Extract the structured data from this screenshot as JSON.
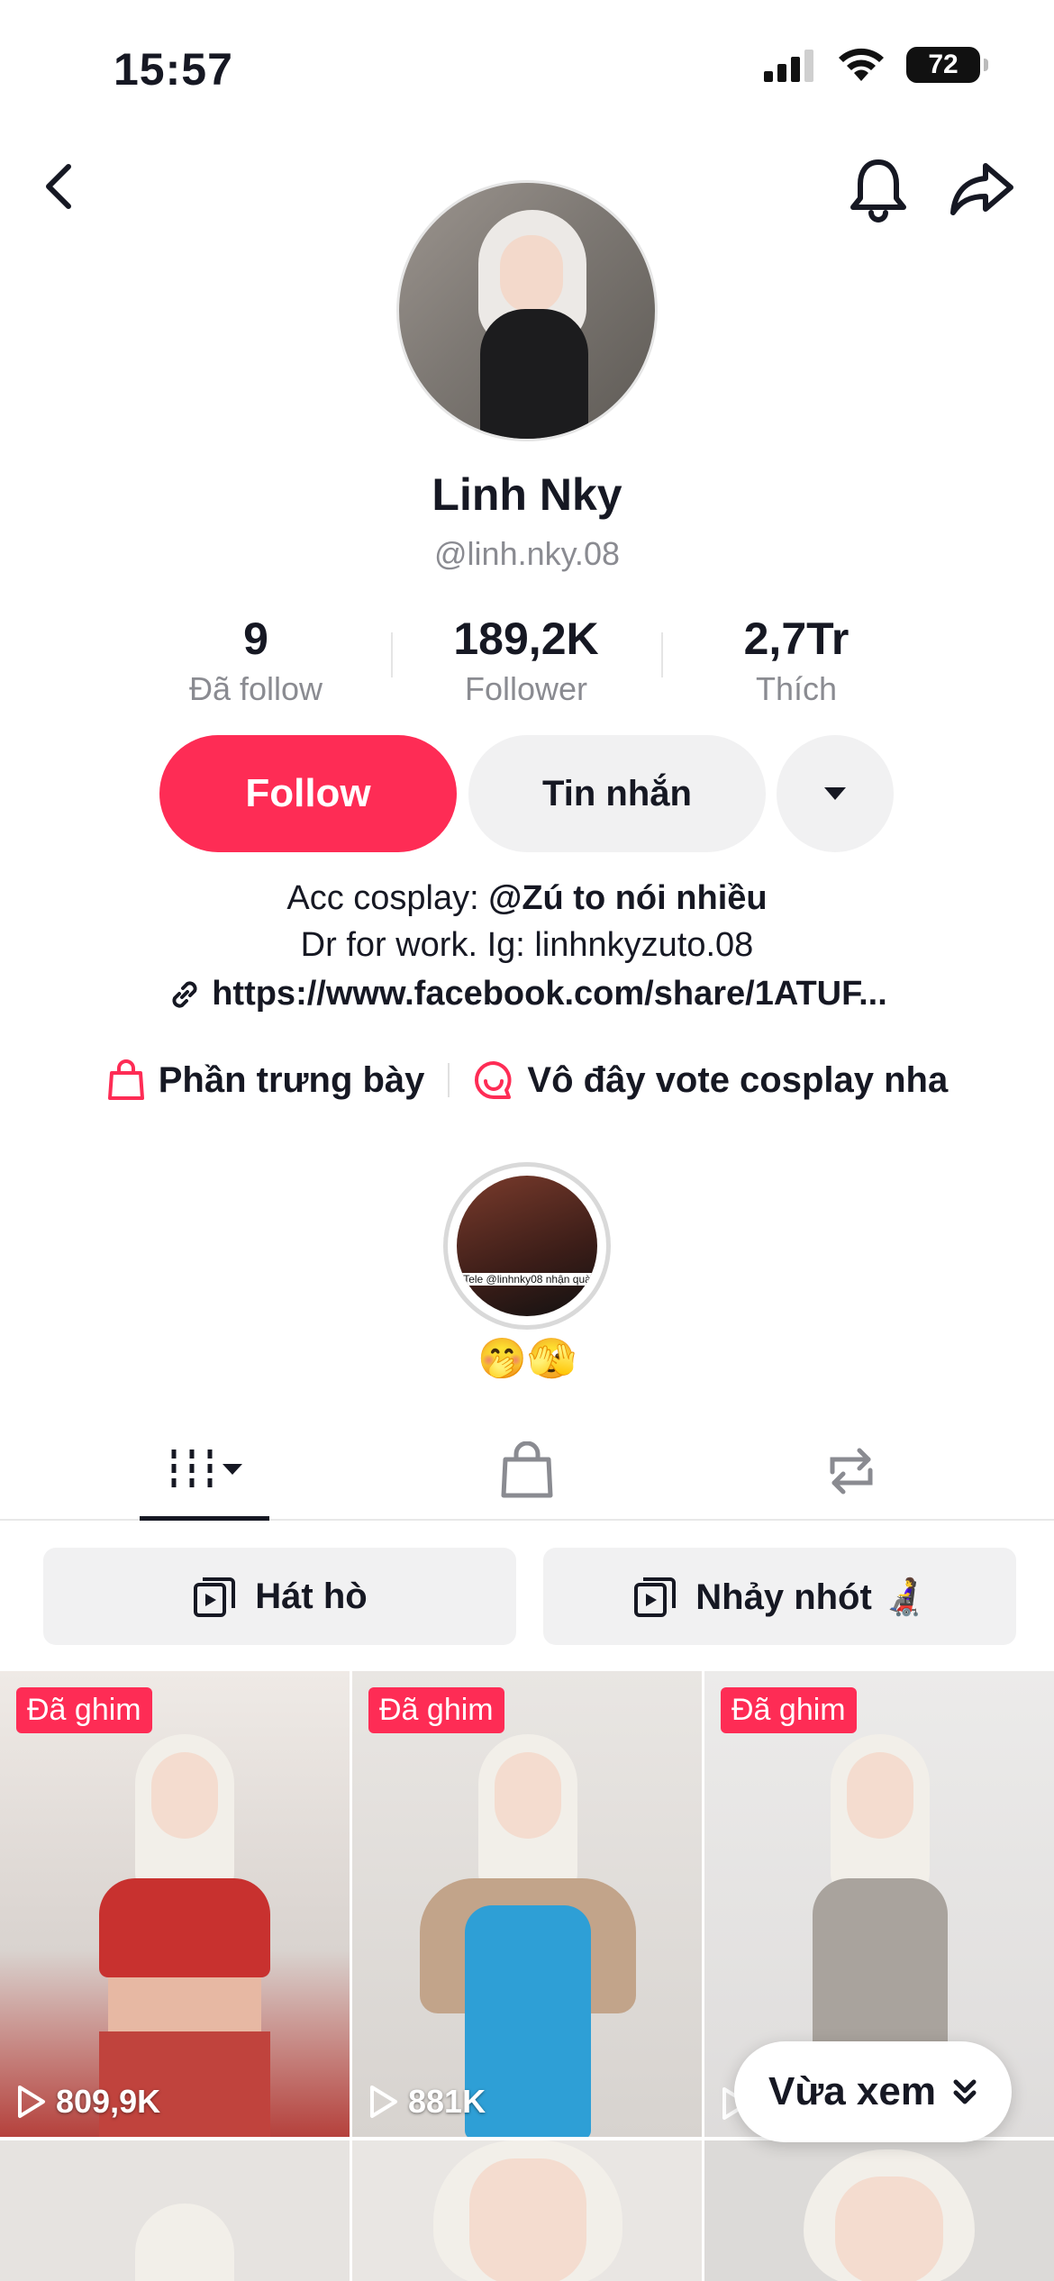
{
  "status_bar": {
    "time": "15:57",
    "battery": "72"
  },
  "profile": {
    "name": "Linh Nky",
    "handle": "@linh.nky.08",
    "stats": [
      {
        "value": "9",
        "label": "Đã follow"
      },
      {
        "value": "189,2K",
        "label": "Follower"
      },
      {
        "value": "2,7Tr",
        "label": "Thích"
      }
    ]
  },
  "actions": {
    "follow": "Follow",
    "message": "Tin nhắn"
  },
  "bio": {
    "line1_prefix": "Acc cosplay: ",
    "line1_mention": "@Zú to nói nhiều",
    "line2": "Dr for work. Ig: linhnkyzuto.08",
    "link": "https://www.facebook.com/share/1ATUF..."
  },
  "links": {
    "showcase": "Phần trưng bày",
    "vote": "Vô đây vote cosplay nha"
  },
  "highlight": {
    "label": "🤭🫣",
    "image_text": "Tele @linhnky08 nhận quà"
  },
  "playlists": [
    {
      "label": "Hát hò"
    },
    {
      "label": "Nhảy nhót 👩‍🦼"
    }
  ],
  "videos": [
    {
      "pinned": "Đã ghim",
      "views": "809,9K"
    },
    {
      "pinned": "Đã ghim",
      "views": "881K"
    },
    {
      "pinned": "Đã ghim",
      "views": ""
    }
  ],
  "recent_button": "Vừa xem",
  "colors": {
    "accent": "#fe2c55",
    "muted": "#8a8b91"
  }
}
